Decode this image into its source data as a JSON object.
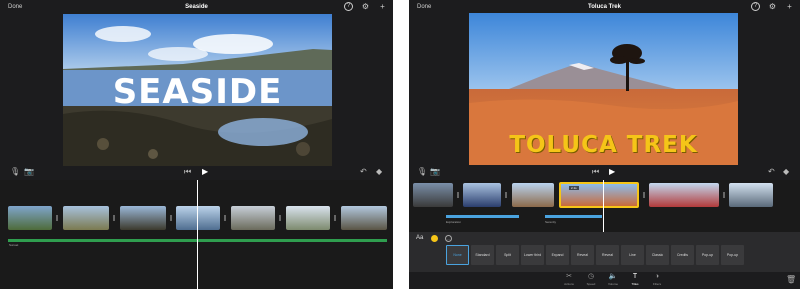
{
  "left_screen": {
    "done_label": "Done",
    "title": "Seaside",
    "overlay_text": "SEASIDE",
    "audio_track_label": "Sunset",
    "top_icons": [
      "help-icon",
      "gear-icon",
      "add-icon"
    ]
  },
  "right_screen": {
    "done_label": "Done",
    "title": "Toluca Trek",
    "header_badge": "Title",
    "overlay_text": "TOLUCA TREK",
    "clip_duration": "2.1s",
    "track_labels": [
      "Exploration",
      "Serenity"
    ],
    "font_toggle_label": "Aa",
    "title_styles": [
      "None",
      "Standard",
      "Split",
      "Lower third",
      "Expand",
      "Reveal",
      "Reveal",
      "Line",
      "Classic",
      "Credits",
      "Pop-up",
      "Pop-up"
    ],
    "selected_style": "None",
    "tabs": [
      "Actions",
      "Speed",
      "Volume",
      "Titles",
      "Filters"
    ],
    "active_tab": "Titles",
    "top_icons": [
      "help-icon",
      "gear-icon",
      "add-icon"
    ],
    "colors": {
      "accent": "#f5c518",
      "selection_blue": "#4aa3df"
    }
  }
}
